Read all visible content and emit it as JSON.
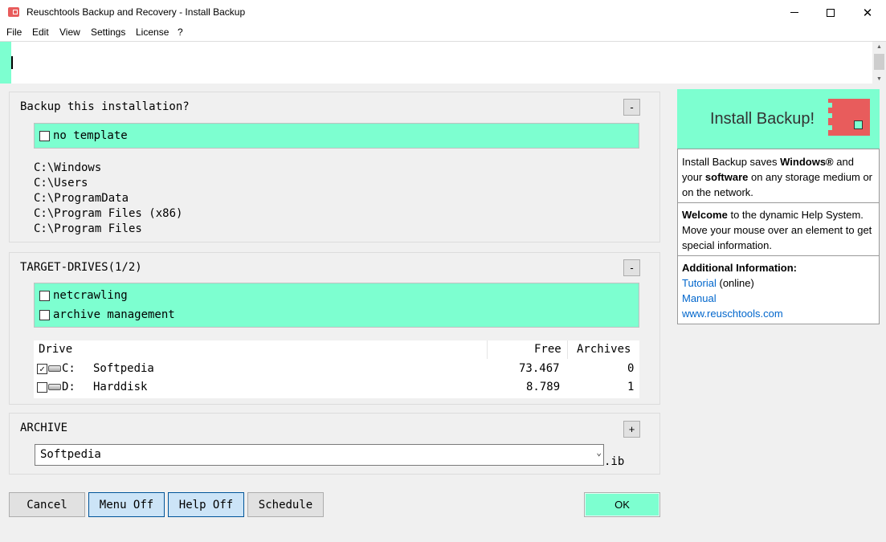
{
  "window": {
    "title": "Reuschtools Backup and Recovery - Install Backup",
    "controls": {
      "minimize": "",
      "maximize": "",
      "close": "✕"
    }
  },
  "menu": [
    "File",
    "Edit",
    "View",
    "Settings",
    "License",
    "?"
  ],
  "backup": {
    "title": "Backup this installation?",
    "toggle": "-",
    "option": "no template",
    "paths": [
      "C:\\Windows",
      "C:\\Users",
      "C:\\ProgramData",
      "C:\\Program Files (x86)",
      "C:\\Program Files"
    ]
  },
  "targets": {
    "title": "TARGET-DRIVES(1/2)",
    "toggle": "-",
    "options": [
      "netcrawling",
      "archive management"
    ],
    "columns": {
      "drive": "Drive",
      "free": "Free",
      "archives": "Archives"
    },
    "drives": [
      {
        "checked": "✓",
        "letter": "C:",
        "name": "Softpedia",
        "free": "73.467",
        "archives": "0"
      },
      {
        "checked": "",
        "letter": "D:",
        "name": "Harddisk",
        "free": "8.789",
        "archives": "1"
      }
    ]
  },
  "archive": {
    "title": "ARCHIVE",
    "toggle": "+",
    "value": "Softpedia",
    "suffix": ".ib"
  },
  "buttons": {
    "cancel": "Cancel",
    "menu_off": "Menu Off",
    "help_off": "Help Off",
    "schedule": "Schedule",
    "ok": "OK"
  },
  "help": {
    "title": "Install Backup!",
    "intro": {
      "p1": "Install Backup saves ",
      "b1": "Windows®",
      "p2": " and your ",
      "b2": "software",
      "p3": " on any storage medium or on the network."
    },
    "welcome": {
      "b": "Welcome",
      "p": " to the dynamic Help System. Move your mouse over an element to get special information."
    },
    "additional": {
      "title": "Additional Information:",
      "tutorial": "Tutorial",
      "online": " (online)",
      "manual": "Manual",
      "site": "www.reuschtools.com"
    }
  },
  "colors": {
    "accent": "#7dffd0",
    "logo": "#e85c5c",
    "link": "#0066cc"
  }
}
